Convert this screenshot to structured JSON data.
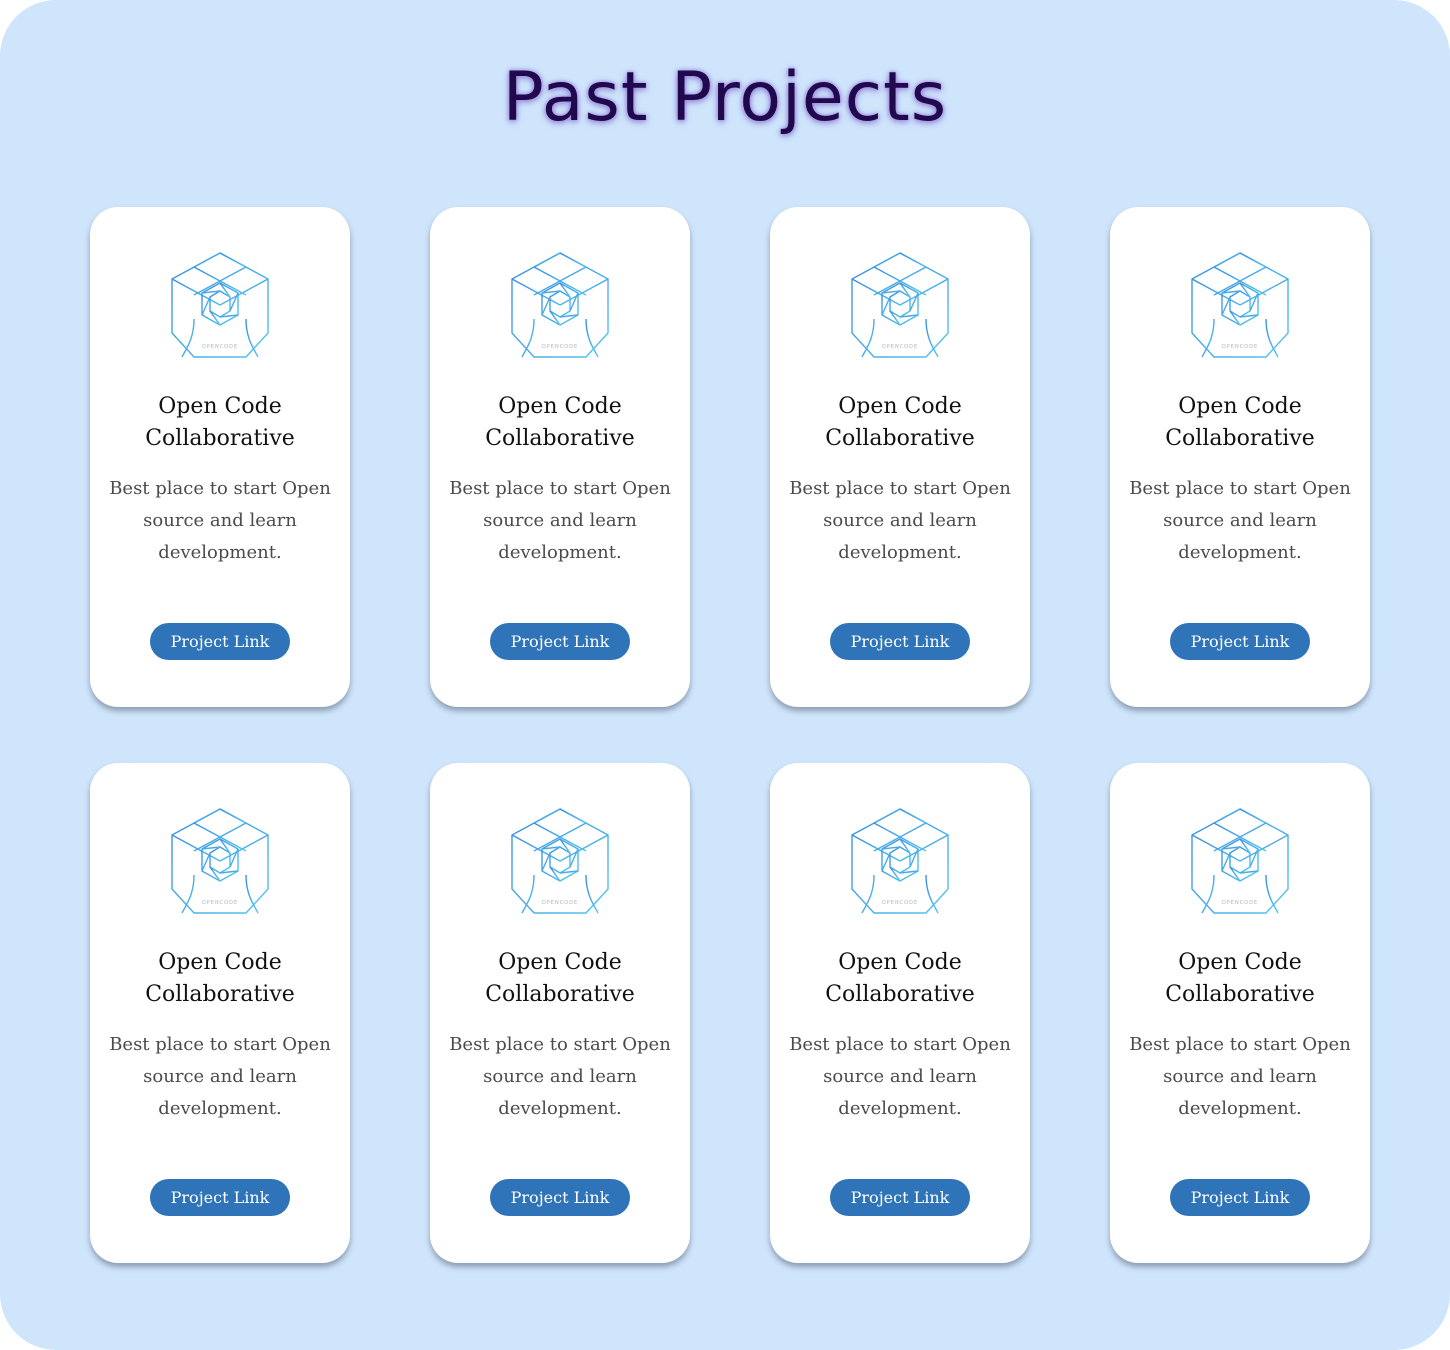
{
  "page": {
    "title": "Past Projects"
  },
  "colors": {
    "background": "#cfe5fc",
    "title": "#20094d",
    "button": "#2f73b8",
    "logo_stroke": "#4aa8e6"
  },
  "projects": [
    {
      "logo_icon": "opencode-hexagon-logo",
      "logo_text": "OPENCODE",
      "title": "Open Code Collaborative",
      "description": "Best place to start Open source and learn development.",
      "button_label": "Project Link"
    },
    {
      "logo_icon": "opencode-hexagon-logo",
      "logo_text": "OPENCODE",
      "title": "Open Code Collaborative",
      "description": "Best place to start Open source and learn development.",
      "button_label": "Project Link"
    },
    {
      "logo_icon": "opencode-hexagon-logo",
      "logo_text": "OPENCODE",
      "title": "Open Code Collaborative",
      "description": "Best place to start Open source and learn development.",
      "button_label": "Project Link"
    },
    {
      "logo_icon": "opencode-hexagon-logo",
      "logo_text": "OPENCODE",
      "title": "Open Code Collaborative",
      "description": "Best place to start Open source and learn development.",
      "button_label": "Project Link"
    },
    {
      "logo_icon": "opencode-hexagon-logo",
      "logo_text": "OPENCODE",
      "title": "Open Code Collaborative",
      "description": "Best place to start Open source and learn development.",
      "button_label": "Project Link"
    },
    {
      "logo_icon": "opencode-hexagon-logo",
      "logo_text": "OPENCODE",
      "title": "Open Code Collaborative",
      "description": "Best place to start Open source and learn development.",
      "button_label": "Project Link"
    },
    {
      "logo_icon": "opencode-hexagon-logo",
      "logo_text": "OPENCODE",
      "title": "Open Code Collaborative",
      "description": "Best place to start Open source and learn development.",
      "button_label": "Project Link"
    },
    {
      "logo_icon": "opencode-hexagon-logo",
      "logo_text": "OPENCODE",
      "title": "Open Code Collaborative",
      "description": "Best place to start Open source and learn development.",
      "button_label": "Project Link"
    }
  ]
}
